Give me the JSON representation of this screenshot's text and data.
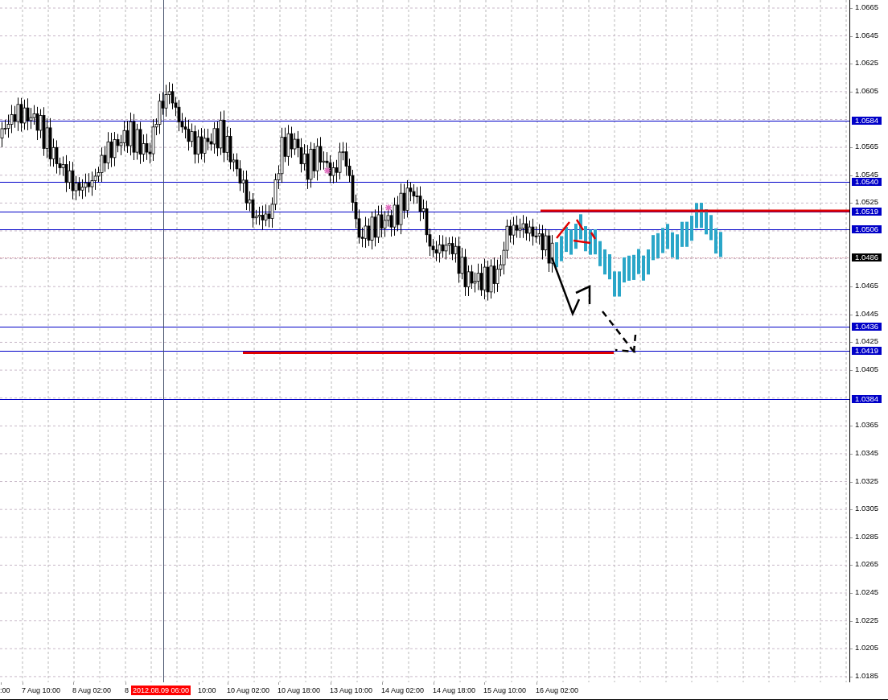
{
  "price_axis": {
    "ticks": [
      "1.0665",
      "1.0645",
      "1.0625",
      "1.0605",
      "1.0565",
      "1.0545",
      "1.0525",
      "1.0465",
      "1.0445",
      "1.0425",
      "1.0405",
      "1.0365",
      "1.0345",
      "1.0325",
      "1.0305",
      "1.0285",
      "1.0265",
      "1.0245",
      "1.0225",
      "1.0205",
      "1.0185"
    ]
  },
  "levels": [
    {
      "label": "1.0584",
      "kind": "level",
      "color": "#0000c8"
    },
    {
      "label": "1.0540",
      "kind": "level",
      "color": "#0000c8"
    },
    {
      "label": "1.0519",
      "kind": "level",
      "color": "#0000c8"
    },
    {
      "label": "1.0506",
      "kind": "level",
      "color": "#0000c8"
    },
    {
      "label": "1.0486",
      "kind": "price",
      "color": "#000000"
    },
    {
      "label": "1.0436",
      "kind": "level",
      "color": "#0000c8"
    },
    {
      "label": "1.0419",
      "kind": "level",
      "color": "#0000c8"
    },
    {
      "label": "1.0384",
      "kind": "level",
      "color": "#0000c8"
    }
  ],
  "time_axis": {
    "labels": [
      {
        "text": ":00",
        "kind": "tick"
      },
      {
        "text": "7 Aug 10:00",
        "kind": "tick"
      },
      {
        "text": "8 Aug 02:00",
        "kind": "tick"
      },
      {
        "text": "8",
        "kind": "tick"
      },
      {
        "text": "2012.08.09 06:00",
        "kind": "cursor"
      },
      {
        "text": "10:00",
        "kind": "tick"
      },
      {
        "text": "10 Aug 02:00",
        "kind": "tick"
      },
      {
        "text": "10 Aug 18:00",
        "kind": "tick"
      },
      {
        "text": "13 Aug 10:00",
        "kind": "tick"
      },
      {
        "text": "14 Aug 02:00",
        "kind": "tick"
      },
      {
        "text": "14 Aug 18:00",
        "kind": "tick"
      },
      {
        "text": "15 Aug 10:00",
        "kind": "tick"
      },
      {
        "text": "16 Aug 02:00",
        "kind": "tick"
      }
    ]
  }
}
